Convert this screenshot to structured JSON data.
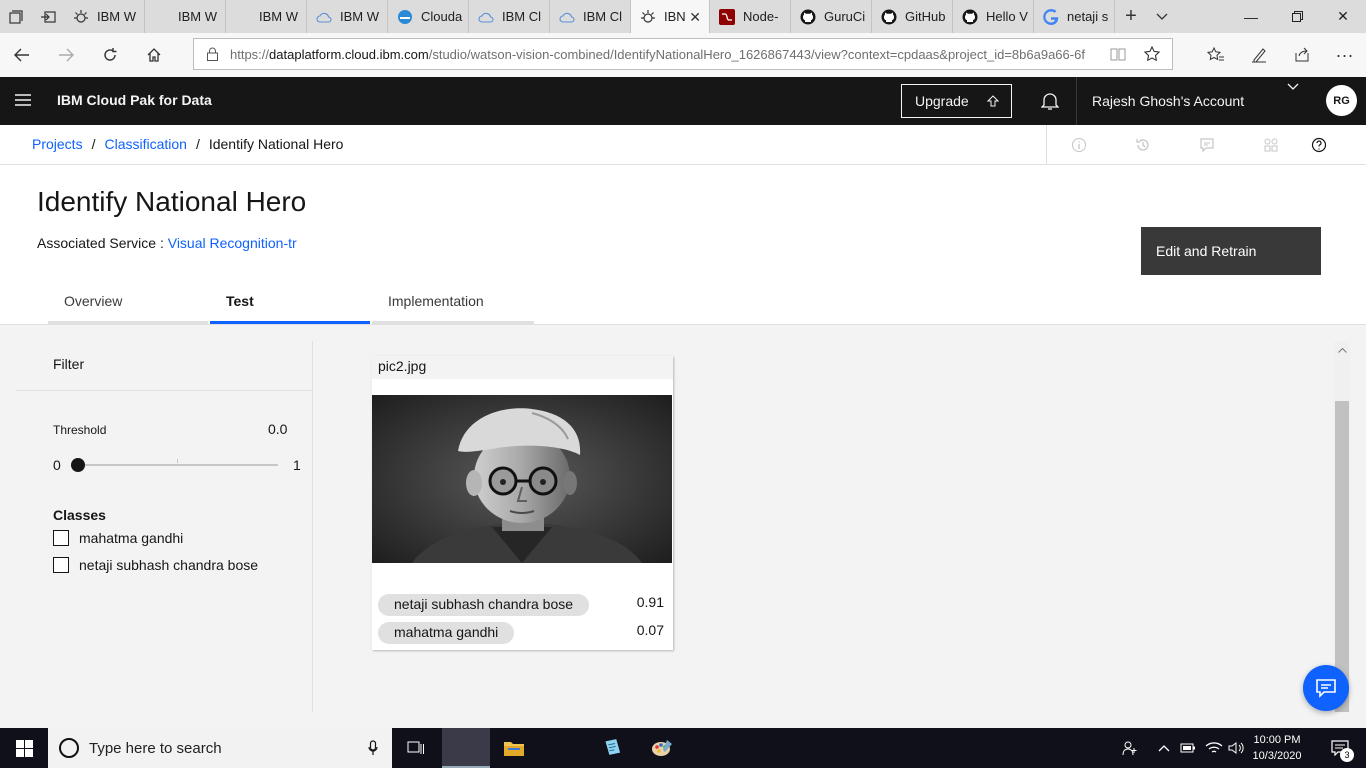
{
  "browser": {
    "tabs": [
      {
        "label": "IBM W",
        "icon": "ibm-watson-icon"
      },
      {
        "label": "IBM W",
        "icon": "none"
      },
      {
        "label": "IBM W",
        "icon": "none"
      },
      {
        "label": "IBM W",
        "icon": "cloud-icon"
      },
      {
        "label": "Clouda",
        "icon": "cloudant-icon"
      },
      {
        "label": "IBM Cl",
        "icon": "cloud-icon"
      },
      {
        "label": "IBM Cl",
        "icon": "cloud-icon"
      },
      {
        "label": "IBN",
        "icon": "ibm-watson-icon",
        "active": true
      },
      {
        "label": "Node-",
        "icon": "node-red-icon"
      },
      {
        "label": "GuruCi",
        "icon": "github-icon"
      },
      {
        "label": "GitHub",
        "icon": "github-icon"
      },
      {
        "label": "Hello V",
        "icon": "github-icon"
      },
      {
        "label": "netaji s",
        "icon": "google-icon"
      }
    ],
    "url_prefix": "https://",
    "url_host": "dataplatform.cloud.ibm.com",
    "url_path": "/studio/watson-vision-combined/IdentifyNationalHero_1626867443/view?context=cpdaas&project_id=8b6a9a66-6f"
  },
  "header": {
    "product": "IBM Cloud Pak for Data",
    "upgrade_label": "Upgrade",
    "account": "Rajesh Ghosh's Account",
    "avatar": "RG"
  },
  "breadcrumb": {
    "items": [
      "Projects",
      "Classification",
      "Identify National Hero"
    ],
    "separator": "/"
  },
  "page": {
    "title": "Identify National Hero",
    "associated_label": "Associated Service :",
    "associated_value": "Visual Recognition-tr",
    "retrain_label": "Edit and Retrain",
    "tabs": [
      "Overview",
      "Test",
      "Implementation"
    ],
    "active_tab": "Test"
  },
  "filter": {
    "title": "Filter",
    "threshold_label": "Threshold",
    "threshold_value": "0.0",
    "slider_min": "0",
    "slider_max": "1",
    "slider_fraction": 0.0,
    "classes_title": "Classes",
    "classes": [
      "mahatma gandhi",
      "netaji subhash chandra bose"
    ]
  },
  "result": {
    "filename": "pic2.jpg",
    "scores": [
      {
        "label": "netaji subhash chandra bose",
        "score": "0.91"
      },
      {
        "label": "mahatma gandhi",
        "score": "0.07"
      }
    ]
  },
  "taskbar": {
    "search_placeholder": "Type here to search",
    "time": "10:00 PM",
    "date": "10/3/2020",
    "notifications": "3"
  },
  "colors": {
    "accent": "#0f62fe",
    "header_bg": "#161616",
    "retrain_bg": "#393939"
  }
}
